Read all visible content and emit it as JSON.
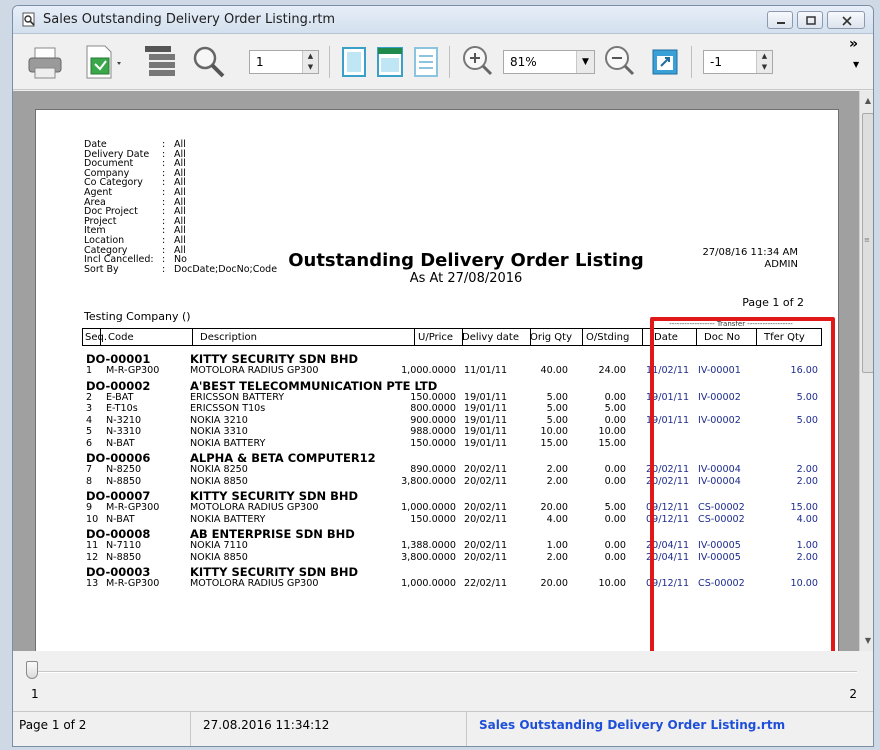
{
  "window": {
    "title": "Sales Outstanding Delivery Order Listing.rtm"
  },
  "toolbar": {
    "page_value": "1",
    "zoom_value": "81%",
    "offset_value": "-1",
    "overflow_label": "»"
  },
  "report": {
    "params": [
      {
        "key": "Date",
        "value": "All"
      },
      {
        "key": "Delivery Date",
        "value": "All"
      },
      {
        "key": "Document",
        "value": "All"
      },
      {
        "key": "Company",
        "value": "All"
      },
      {
        "key": "Co Category",
        "value": "All"
      },
      {
        "key": "Agent",
        "value": "All"
      },
      {
        "key": "Area",
        "value": "All"
      },
      {
        "key": "Doc Project",
        "value": "All"
      },
      {
        "key": "Project",
        "value": "All"
      },
      {
        "key": "Item",
        "value": "All"
      },
      {
        "key": "Location",
        "value": "All"
      },
      {
        "key": "Category",
        "value": "All"
      },
      {
        "key": "Incl Cancelled:",
        "value": "No"
      },
      {
        "key": "Sort By",
        "value": "DocDate;DocNo;Code"
      }
    ],
    "title": "Outstanding Delivery Order Listing",
    "subtitle": "As At 27/08/2016",
    "timestamp": "27/08/16 11:34 AM",
    "user": "ADMIN",
    "page_info": "Page 1 of 2",
    "company": "Testing Company ()",
    "transfer_label": "------------------ Transfer ------------------",
    "columns": [
      "Seq.",
      "Code",
      "Description",
      "U/Price",
      "Delivy date",
      "Orig Qty",
      "O/Stding",
      "Date",
      "Doc No",
      "Tfer Qty"
    ],
    "groups": [
      {
        "doc": "DO-00001",
        "customer": "KITTY SECURITY SDN BHD",
        "lines": [
          {
            "seq": "1",
            "code": "M-R-GP300",
            "desc": "MOTOLORA RADIUS GP300",
            "price": "1,000.0000",
            "ddate": "11/01/11",
            "orig": "40.00",
            "out": "24.00",
            "tdate": "11/02/11",
            "tdoc": "IV-00001",
            "tqty": "16.00"
          }
        ]
      },
      {
        "doc": "DO-00002",
        "customer": "A'BEST TELECOMMUNICATION PTE LTD",
        "lines": [
          {
            "seq": "2",
            "code": "E-BAT",
            "desc": "ERICSSON BATTERY",
            "price": "150.0000",
            "ddate": "19/01/11",
            "orig": "5.00",
            "out": "0.00",
            "tdate": "19/01/11",
            "tdoc": "IV-00002",
            "tqty": "5.00"
          },
          {
            "seq": "3",
            "code": "E-T10s",
            "desc": "ERICSSON T10s",
            "price": "800.0000",
            "ddate": "19/01/11",
            "orig": "5.00",
            "out": "5.00",
            "tdate": "",
            "tdoc": "",
            "tqty": ""
          },
          {
            "seq": "4",
            "code": "N-3210",
            "desc": "NOKIA 3210",
            "price": "900.0000",
            "ddate": "19/01/11",
            "orig": "5.00",
            "out": "0.00",
            "tdate": "19/01/11",
            "tdoc": "IV-00002",
            "tqty": "5.00"
          },
          {
            "seq": "5",
            "code": "N-3310",
            "desc": "NOKIA 3310",
            "price": "988.0000",
            "ddate": "19/01/11",
            "orig": "10.00",
            "out": "10.00",
            "tdate": "",
            "tdoc": "",
            "tqty": ""
          },
          {
            "seq": "6",
            "code": "N-BAT",
            "desc": "NOKIA BATTERY",
            "price": "150.0000",
            "ddate": "19/01/11",
            "orig": "15.00",
            "out": "15.00",
            "tdate": "",
            "tdoc": "",
            "tqty": ""
          }
        ]
      },
      {
        "doc": "DO-00006",
        "customer": "ALPHA & BETA COMPUTER12",
        "lines": [
          {
            "seq": "7",
            "code": "N-8250",
            "desc": "NOKIA 8250",
            "price": "890.0000",
            "ddate": "20/02/11",
            "orig": "2.00",
            "out": "0.00",
            "tdate": "20/02/11",
            "tdoc": "IV-00004",
            "tqty": "2.00"
          },
          {
            "seq": "8",
            "code": "N-8850",
            "desc": "NOKIA 8850",
            "price": "3,800.0000",
            "ddate": "20/02/11",
            "orig": "2.00",
            "out": "0.00",
            "tdate": "20/02/11",
            "tdoc": "IV-00004",
            "tqty": "2.00"
          }
        ]
      },
      {
        "doc": "DO-00007",
        "customer": "KITTY SECURITY SDN BHD",
        "lines": [
          {
            "seq": "9",
            "code": "M-R-GP300",
            "desc": "MOTOLORA RADIUS GP300",
            "price": "1,000.0000",
            "ddate": "20/02/11",
            "orig": "20.00",
            "out": "5.00",
            "tdate": "09/12/11",
            "tdoc": "CS-00002",
            "tqty": "15.00"
          },
          {
            "seq": "10",
            "code": "N-BAT",
            "desc": "NOKIA BATTERY",
            "price": "150.0000",
            "ddate": "20/02/11",
            "orig": "4.00",
            "out": "0.00",
            "tdate": "09/12/11",
            "tdoc": "CS-00002",
            "tqty": "4.00"
          }
        ]
      },
      {
        "doc": "DO-00008",
        "customer": "AB ENTERPRISE SDN BHD",
        "lines": [
          {
            "seq": "11",
            "code": "N-7110",
            "desc": "NOKIA 7110",
            "price": "1,388.0000",
            "ddate": "20/02/11",
            "orig": "1.00",
            "out": "0.00",
            "tdate": "20/04/11",
            "tdoc": "IV-00005",
            "tqty": "1.00"
          },
          {
            "seq": "12",
            "code": "N-8850",
            "desc": "NOKIA 8850",
            "price": "3,800.0000",
            "ddate": "20/02/11",
            "orig": "2.00",
            "out": "0.00",
            "tdate": "20/04/11",
            "tdoc": "IV-00005",
            "tqty": "2.00"
          }
        ]
      },
      {
        "doc": "DO-00003",
        "customer": "KITTY SECURITY SDN BHD",
        "lines": [
          {
            "seq": "13",
            "code": "M-R-GP300",
            "desc": "MOTOLORA RADIUS GP300",
            "price": "1,000.0000",
            "ddate": "22/02/11",
            "orig": "20.00",
            "out": "10.00",
            "tdate": "09/12/11",
            "tdoc": "CS-00002",
            "tqty": "10.00"
          }
        ]
      }
    ]
  },
  "slider": {
    "min_label": "1",
    "max_label": "2"
  },
  "status": {
    "page": "Page 1 of 2",
    "datetime": "27.08.2016 11:34:12",
    "filename": "Sales Outstanding Delivery Order Listing.rtm"
  },
  "colors": {
    "highlight": "#e01818",
    "transfer_text": "#1e2c8c",
    "status_filename": "#1e4fd8"
  }
}
